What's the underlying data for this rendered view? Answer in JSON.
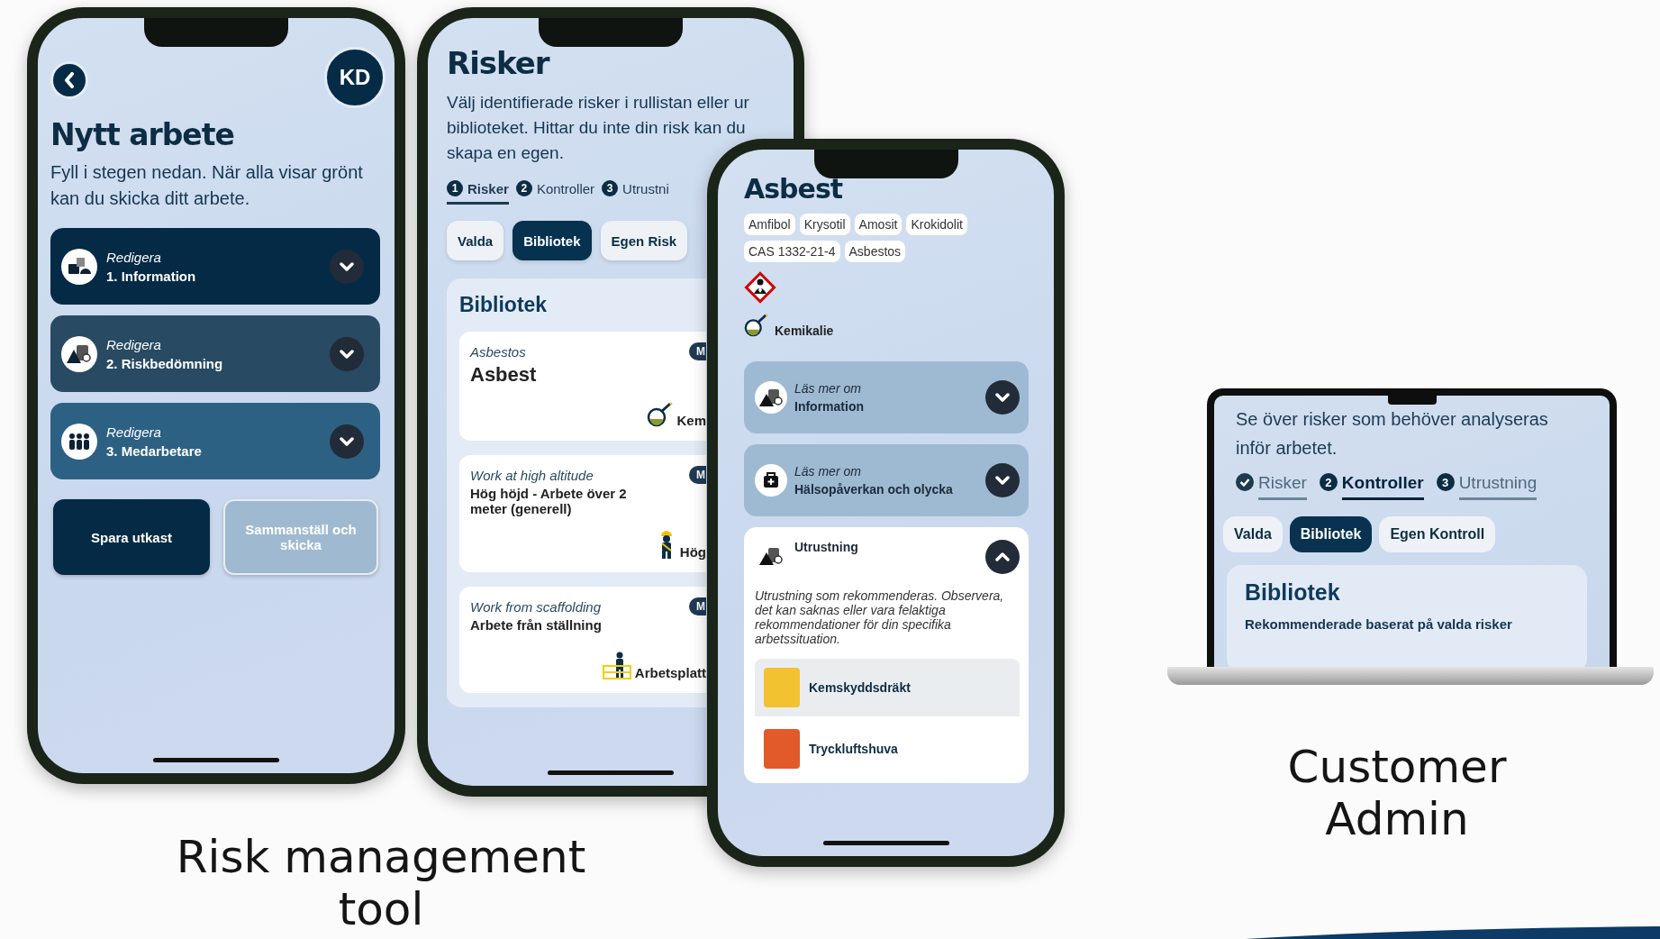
{
  "new_work_screen": {
    "avatar": "KD",
    "title": "Nytt arbete",
    "description": "Fyll i stegen nedan. När alla visar grönt kan du skicka ditt arbete.",
    "steps": [
      {
        "action": "Redigera",
        "label": "1. Information",
        "color": "#052a45"
      },
      {
        "action": "Redigera",
        "label": "2. Riskbedömning",
        "color": "#284a62"
      },
      {
        "action": "Redigera",
        "label": "3. Medarbetare",
        "color": "#2d6184"
      }
    ],
    "buttons": [
      {
        "label": "Spara utkast",
        "disabled": false
      },
      {
        "label": "Sammanställ och skicka",
        "disabled": true
      }
    ]
  },
  "risks_screen": {
    "title": "Risker",
    "description": "Välj identifierade risker i rullistan eller ur biblioteket.  Hittar du inte din risk kan du skapa en egen.",
    "steps": [
      {
        "number": "1",
        "label": "Risker",
        "selected": true
      },
      {
        "number": "2",
        "label": "Kontroller",
        "selected": false
      },
      {
        "number": "3",
        "label": "Utrustni",
        "selected": false
      }
    ],
    "filters": [
      {
        "label": "Valda",
        "selected": false
      },
      {
        "label": "Bibliotek",
        "selected": true
      },
      {
        "label": "Egen Risk",
        "selected": false
      }
    ],
    "library": {
      "title": "Bibliotek",
      "items": [
        {
          "subtitle": "Asbestos",
          "title": "Asbest",
          "badge": "M",
          "category": "Kem"
        },
        {
          "subtitle": "Work at high altitude",
          "title": "Hög höjd - Arbete över 2 meter (generell)",
          "badge": "M",
          "category": "Hög"
        },
        {
          "subtitle": "Work from scaffolding",
          "title": "Arbete från ställning",
          "badge": "M",
          "category": "Arbetsplatt"
        }
      ]
    }
  },
  "asbestos_screen": {
    "title": "Asbest",
    "tags": [
      "Amfibol",
      "Krysotil",
      "Amosit",
      "Krokidolit",
      "CAS 1332-21-4",
      "Asbestos"
    ],
    "category": "Kemikalie",
    "sections": [
      {
        "prefix": "Läs mer om",
        "title": "Information",
        "expanded": false
      },
      {
        "prefix": "Läs mer om",
        "title": "Hälsopåverkan och olycka",
        "expanded": false
      },
      {
        "title": "Utrustning",
        "expanded": true,
        "description": "Utrustning som rekommenderas. Observera, det kan saknas eller vara felaktiga rekommendationer för din specifika arbetssituation.",
        "items": [
          "Kemskyddsdräkt",
          "Tryckluftshuva"
        ]
      }
    ]
  },
  "admin_screen": {
    "description": "Se över risker som behöver analyseras inför arbetet.",
    "steps": [
      {
        "label": "Risker",
        "done": true,
        "selected": false
      },
      {
        "number": "2",
        "label": "Kontroller",
        "done": false,
        "selected": true
      },
      {
        "number": "3",
        "label": "Utrustning",
        "done": false,
        "selected": false
      }
    ],
    "filters": [
      {
        "label": "Valda",
        "selected": false
      },
      {
        "label": "Bibliotek",
        "selected": true
      },
      {
        "label": "Egen Kontroll",
        "selected": false
      }
    ],
    "library": {
      "title": "Bibliotek",
      "subtitle": "Rekommenderade baserat på valda risker"
    }
  },
  "captions": [
    "Risk management tool",
    "Customer Admin"
  ]
}
